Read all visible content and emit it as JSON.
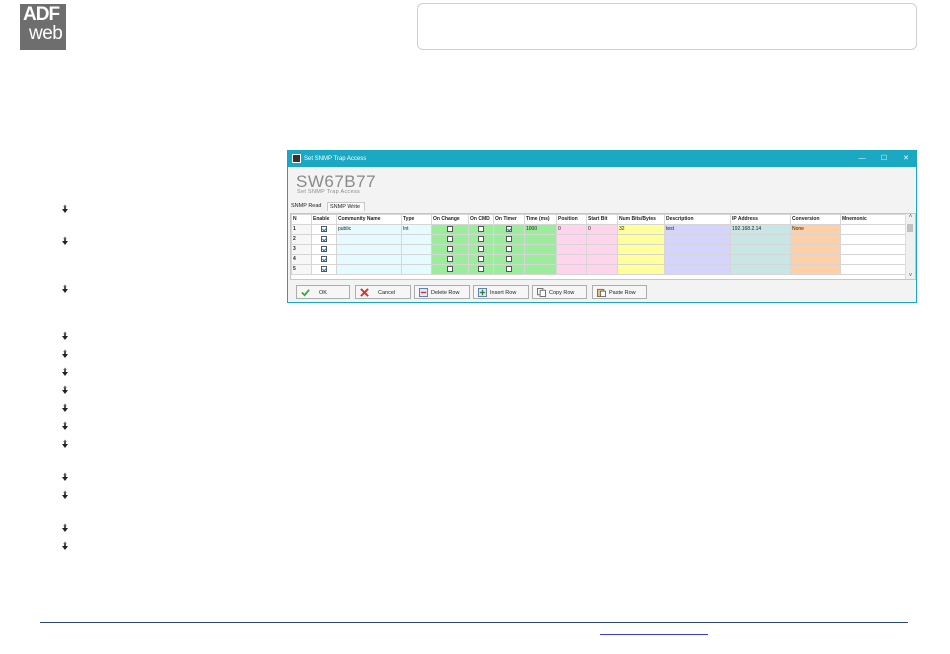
{
  "logo": {
    "line1": "ADF",
    "line2": "web"
  },
  "dialog": {
    "window_title": "Set SNMP Trap Access",
    "controls": {
      "minimize": "—",
      "maximize": "☐",
      "close": "✕"
    },
    "big_title": "SW67B77",
    "sub_title": "Set SNMP Trap Access",
    "tabs": [
      {
        "label": "SNMP Read"
      },
      {
        "label": "SNMP Write"
      }
    ],
    "columns": [
      "N",
      "Enable",
      "Community Name",
      "Type",
      "On Change",
      "On CMD",
      "On Timer",
      "Time (ms)",
      "Position",
      "Start Bit",
      "Num Bits/Bytes",
      "Description",
      "IP Address",
      "Conversion",
      "Mnemonic"
    ],
    "rows": [
      {
        "n": "1",
        "enable": true,
        "community": "public",
        "type": "Int",
        "on_change": false,
        "on_cmd": false,
        "on_timer": true,
        "time": "1000",
        "position": "0",
        "start_bit": "0",
        "num_bits": "32",
        "description": "test",
        "ip": "192.168.2.14",
        "conversion": "None",
        "mnemonic": ""
      },
      {
        "n": "2",
        "enable": true,
        "community": "",
        "type": "",
        "on_change": false,
        "on_cmd": false,
        "on_timer": false,
        "time": "",
        "position": "",
        "start_bit": "",
        "num_bits": "",
        "description": "",
        "ip": "",
        "conversion": "",
        "mnemonic": ""
      },
      {
        "n": "3",
        "enable": true,
        "community": "",
        "type": "",
        "on_change": false,
        "on_cmd": false,
        "on_timer": false,
        "time": "",
        "position": "",
        "start_bit": "",
        "num_bits": "",
        "description": "",
        "ip": "",
        "conversion": "",
        "mnemonic": ""
      },
      {
        "n": "4",
        "enable": true,
        "community": "",
        "type": "",
        "on_change": false,
        "on_cmd": false,
        "on_timer": false,
        "time": "",
        "position": "",
        "start_bit": "",
        "num_bits": "",
        "description": "",
        "ip": "",
        "conversion": "",
        "mnemonic": ""
      },
      {
        "n": "5",
        "enable": true,
        "community": "",
        "type": "",
        "on_change": false,
        "on_cmd": false,
        "on_timer": false,
        "time": "",
        "position": "",
        "start_bit": "",
        "num_bits": "",
        "description": "",
        "ip": "",
        "conversion": "",
        "mnemonic": ""
      }
    ],
    "column_colors": {
      "community": "#e6fbff",
      "type": "#e6fbff",
      "on_change": "#9bec9b",
      "on_cmd": "#9bec9b",
      "on_timer": "#9bec9b",
      "time": "#9bec9b",
      "position": "#ffd4ec",
      "start_bit": "#ffd4ec",
      "num_bits": "#ffff9c",
      "description": "#d4d4ff",
      "ip": "#c8e6e6",
      "conversion": "#ffd0a8",
      "mnemonic": "#ffffff"
    },
    "buttons": [
      {
        "label": "OK",
        "icon": "check-icon"
      },
      {
        "label": "Cancel",
        "icon": "x-icon"
      },
      {
        "label": "Delete Row",
        "icon": "delete-row-icon"
      },
      {
        "label": "Insert Row",
        "icon": "insert-row-icon"
      },
      {
        "label": "Copy Row",
        "icon": "copy-icon"
      },
      {
        "label": "Paste Row",
        "icon": "paste-icon"
      }
    ]
  },
  "bullet_count": 15
}
